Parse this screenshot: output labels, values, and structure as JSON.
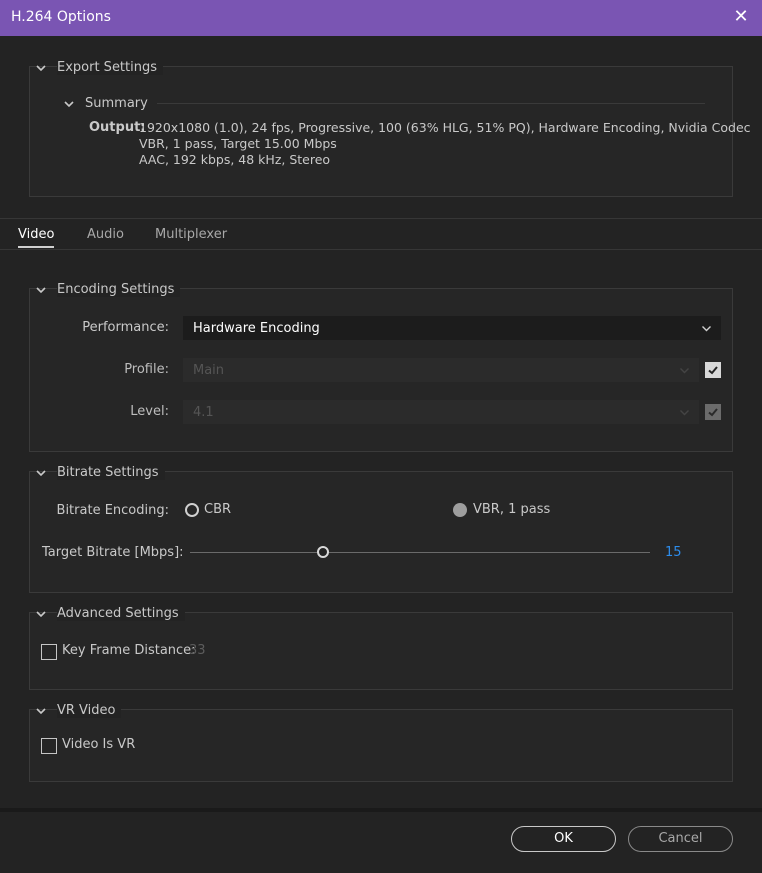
{
  "window": {
    "title": "H.264 Options",
    "close_glyph": "✕"
  },
  "export_settings": {
    "heading": "Export Settings",
    "summary": {
      "heading": "Summary",
      "output_label": "Output:",
      "lines": [
        "1920x1080 (1.0), 24 fps, Progressive, 100 (63% HLG, 51% PQ), Hardware Encoding, Nvidia Codec",
        "VBR, 1 pass, Target 15.00 Mbps",
        "AAC, 192 kbps, 48 kHz, Stereo"
      ]
    }
  },
  "tabs": [
    {
      "label": "Video",
      "active": true
    },
    {
      "label": "Audio",
      "active": false
    },
    {
      "label": "Multiplexer",
      "active": false
    }
  ],
  "encoding_settings": {
    "heading": "Encoding Settings",
    "performance": {
      "label": "Performance:",
      "value": "Hardware Encoding"
    },
    "profile": {
      "label": "Profile:",
      "value": "Main",
      "checked": true
    },
    "level": {
      "label": "Level:",
      "value": "4.1",
      "checked": true
    }
  },
  "bitrate_settings": {
    "heading": "Bitrate Settings",
    "encoding_label": "Bitrate Encoding:",
    "options": [
      {
        "label": "CBR",
        "selected": false
      },
      {
        "label": "VBR, 1 pass",
        "selected": true
      }
    ],
    "target": {
      "label": "Target Bitrate [Mbps]:",
      "value": "15",
      "fraction": 0.29
    }
  },
  "advanced_settings": {
    "heading": "Advanced Settings",
    "key_frame": {
      "label": "Key Frame Distance:",
      "value": "33",
      "checked": false
    }
  },
  "vr_video": {
    "heading": "VR Video",
    "video_is_vr": {
      "label": "Video Is VR",
      "checked": false
    }
  },
  "footer": {
    "ok_label": "OK",
    "cancel_label": "Cancel"
  },
  "icons": {
    "close": "close-icon",
    "collapse": "chevron-down-icon",
    "dropdown": "dropdown-arrow-icon",
    "check": "check-icon"
  },
  "colors": {
    "titlebar": "#7a55b3",
    "background": "#232323",
    "accent_value": "#2d8ceb"
  }
}
